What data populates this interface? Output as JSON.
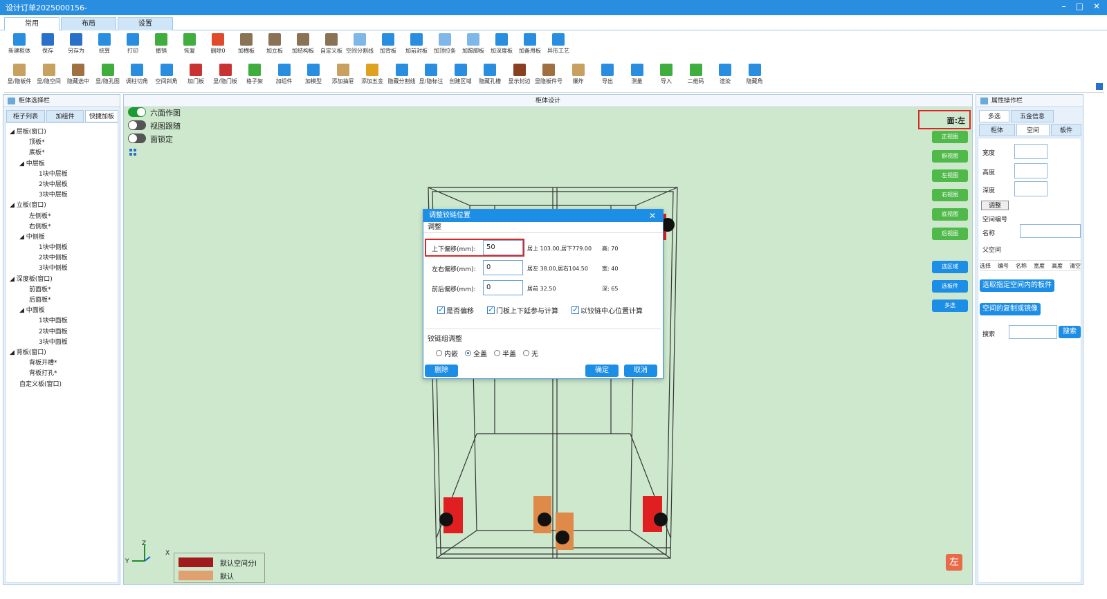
{
  "window": {
    "title": "设计订单2025000156-",
    "min": "–",
    "max": "□",
    "close": "✕"
  },
  "ribbon_tabs": [
    "常用",
    "布局",
    "设置"
  ],
  "toolbar_row1": [
    {
      "label": "新建柜体",
      "color": "#2a8ee0"
    },
    {
      "label": "保存",
      "color": "#2a70c8"
    },
    {
      "label": "另存为",
      "color": "#2a70c8"
    },
    {
      "label": "统算",
      "color": "#2a8ee0"
    },
    {
      "label": "打印",
      "color": "#2a8ee0"
    },
    {
      "label": "撤销",
      "color": "#3fae3f"
    },
    {
      "label": "恢复",
      "color": "#3fae3f"
    },
    {
      "label": "删除0",
      "color": "#e04a2a"
    },
    {
      "label": "加横板",
      "color": "#8a7355"
    },
    {
      "label": "加立板",
      "color": "#8a7355"
    },
    {
      "label": "加结构板",
      "color": "#8a7355"
    },
    {
      "label": "自定义板",
      "color": "#8a7355"
    },
    {
      "label": "空间分割线",
      "color": "#7fb8e8"
    },
    {
      "label": "加背板",
      "color": "#2a8ee0"
    },
    {
      "label": "加前封板",
      "color": "#2a8ee0"
    },
    {
      "label": "加顶拉条",
      "color": "#7fb8e8"
    },
    {
      "label": "加踢脚板",
      "color": "#7fb8e8"
    },
    {
      "label": "加深度板",
      "color": "#2a8ee0"
    },
    {
      "label": "加备用板",
      "color": "#2a8ee0"
    },
    {
      "label": "异形工艺",
      "color": "#2a8ee0"
    }
  ],
  "toolbar_row2": [
    {
      "label": "显/隐板件",
      "color": "#c8a060"
    },
    {
      "label": "显/隐空间",
      "color": "#c8a060"
    },
    {
      "label": "隐藏选中",
      "color": "#a07040"
    },
    {
      "label": "显/隐孔图",
      "color": "#3fae3f"
    },
    {
      "label": "调柱切角",
      "color": "#2a8ee0"
    },
    {
      "label": "空间斜角",
      "color": "#2a8ee0"
    },
    {
      "label": "加门板",
      "color": "#c83232"
    },
    {
      "label": "显/隐门板",
      "color": "#c83232"
    },
    {
      "label": "格子架",
      "color": "#3fae3f"
    },
    {
      "label": "加组件",
      "color": "#2a8ee0"
    },
    {
      "label": "加模型",
      "color": "#2a8ee0"
    },
    {
      "label": "添加抽屉",
      "color": "#c8a060"
    },
    {
      "label": "添加五金",
      "color": "#e0a020"
    },
    {
      "label": "隐藏分割线",
      "color": "#2a8ee0"
    },
    {
      "label": "显/隐标注",
      "color": "#2a8ee0"
    },
    {
      "label": "创建区域",
      "color": "#2a8ee0"
    },
    {
      "label": "隐藏孔槽",
      "color": "#2a8ee0"
    },
    {
      "label": "显示封边",
      "color": "#8a4020"
    },
    {
      "label": "显隐板件号",
      "color": "#a07040"
    },
    {
      "label": "爆炸",
      "color": "#c8a060"
    },
    {
      "label": "导出",
      "color": "#2a8ee0"
    },
    {
      "label": "测量",
      "color": "#2a8ee0"
    },
    {
      "label": "导入",
      "color": "#3fae3f"
    },
    {
      "label": "二维码",
      "color": "#3fae3f"
    },
    {
      "label": "渲染",
      "color": "#2a8ee0"
    },
    {
      "label": "隐藏角",
      "color": "#2a8ee0"
    }
  ],
  "left_panel": {
    "title": "柜体选择栏",
    "tabs": [
      "柜子列表",
      "加组件",
      "快捷加板"
    ],
    "tree": [
      {
        "t": "◢ 层板(窗口)",
        "lvl": 0
      },
      {
        "t": "顶板*",
        "lvl": 2
      },
      {
        "t": "底板*",
        "lvl": 2
      },
      {
        "t": "◢ 中层板",
        "lvl": 1
      },
      {
        "t": "1块中层板",
        "lvl": 3
      },
      {
        "t": "2块中层板",
        "lvl": 3
      },
      {
        "t": "3块中层板",
        "lvl": 3
      },
      {
        "t": "◢ 立板(窗口)",
        "lvl": 0
      },
      {
        "t": "左侧板*",
        "lvl": 2
      },
      {
        "t": "右侧板*",
        "lvl": 2
      },
      {
        "t": "◢ 中侧板",
        "lvl": 1
      },
      {
        "t": "1块中侧板",
        "lvl": 3
      },
      {
        "t": "2块中侧板",
        "lvl": 3
      },
      {
        "t": "3块中侧板",
        "lvl": 3
      },
      {
        "t": "◢ 深度板(窗口)",
        "lvl": 0
      },
      {
        "t": "前面板*",
        "lvl": 2
      },
      {
        "t": "后面板*",
        "lvl": 2
      },
      {
        "t": "◢ 中面板",
        "lvl": 1
      },
      {
        "t": "1块中面板",
        "lvl": 3
      },
      {
        "t": "2块中面板",
        "lvl": 3
      },
      {
        "t": "3块中面板",
        "lvl": 3
      },
      {
        "t": "◢ 背板(窗口)",
        "lvl": 0
      },
      {
        "t": "背板开槽*",
        "lvl": 2
      },
      {
        "t": "背板打孔*",
        "lvl": 2
      },
      {
        "t": "自定义板(窗口)",
        "lvl": 1
      }
    ]
  },
  "view": {
    "title": "柜体设计",
    "toggles": [
      {
        "label": "六面作图",
        "on": true
      },
      {
        "label": "视图跟随",
        "on": false
      },
      {
        "label": "面锁定",
        "on": false
      }
    ],
    "face_label": "面:左",
    "view_buttons": [
      "正视图",
      "俯视图",
      "左视图",
      "右视图",
      "底视图",
      "后视图"
    ],
    "select_buttons": [
      "选区域",
      "选板件",
      "多选"
    ],
    "axis": {
      "z": "Z",
      "y": "Y",
      "x": "X"
    },
    "legend": [
      {
        "label": "默认空间分l",
        "color": "#a01c1c"
      },
      {
        "label": "默认",
        "color": "#e0a070"
      }
    ],
    "corner_badge": "左"
  },
  "dialog": {
    "title": "调整铰链位置",
    "close": "✕",
    "section1": "调整",
    "rows": [
      {
        "label": "上下偏移(mm):",
        "value": "50",
        "info1": "居上 103.00,居下779.00",
        "info2": "高: 70"
      },
      {
        "label": "左右偏移(mm):",
        "value": "0",
        "info1": "居左 38.00,居右104.50",
        "info2": "宽: 40"
      },
      {
        "label": "前后偏移(mm):",
        "value": "0",
        "info1": "居前 32.50",
        "info2": "深: 65"
      }
    ],
    "checks": [
      "是否偏移",
      "门板上下延参与计算",
      "以铰链中心位置计算"
    ],
    "section2": "铰链组调整",
    "radios": [
      {
        "label": "内嵌",
        "sel": false
      },
      {
        "label": "全盖",
        "sel": true
      },
      {
        "label": "半盖",
        "sel": false
      },
      {
        "label": "无",
        "sel": false
      }
    ],
    "delete_label": "删除",
    "ok_label": "确定",
    "cancel_label": "取消"
  },
  "right_panel": {
    "title": "属性操作栏",
    "tabs_row1": [
      "多选",
      "五金信息"
    ],
    "tabs_row2": [
      "柜体",
      "空间",
      "板件"
    ],
    "width_label": "宽度",
    "height_label": "高度",
    "depth_label": "深度",
    "adjust_label": "调整",
    "space_no_label": "空间编号",
    "name_label": "名称",
    "parent_label": "父空间",
    "columns": [
      "选择",
      "编号",
      "名称",
      "宽度",
      "高度",
      "清空"
    ],
    "select_board_btn": "选取指定空间内的板件",
    "copy_mirror_btn": "空间的复制或镜像",
    "search_label": "搜索",
    "search_btn": "搜索"
  }
}
